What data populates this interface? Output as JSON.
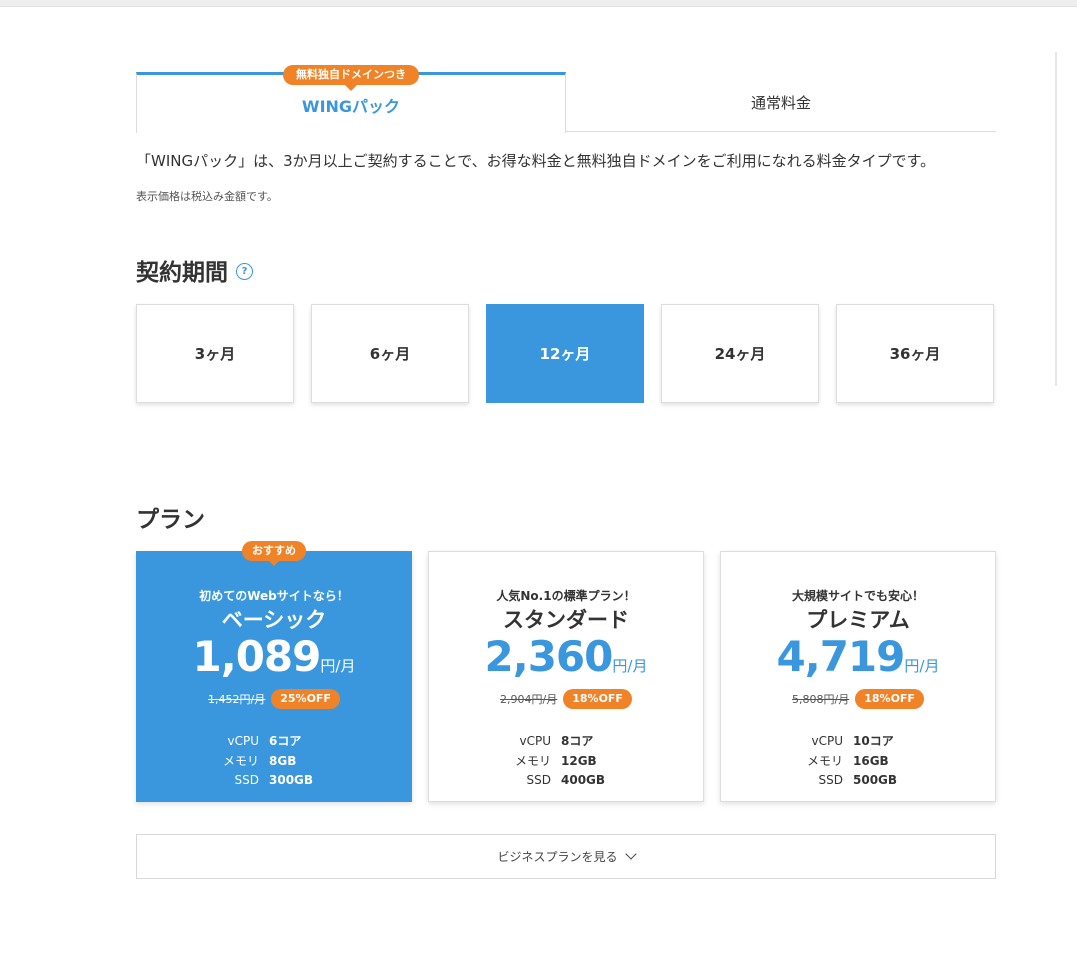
{
  "tabs": {
    "wing": {
      "label": "WINGパック",
      "badge": "無料独自ドメインつき"
    },
    "normal": {
      "label": "通常料金"
    }
  },
  "intro": "「WINGパック」は、3か月以上ご契約することで、お得な料金と無料独自ドメインをご利用になれる料金タイプです。",
  "tax_note": "表示価格は税込み金額です。",
  "period_section": {
    "title": "契約期間",
    "help_icon": "question-circle-icon",
    "options": [
      {
        "label": "3ヶ月"
      },
      {
        "label": "6ヶ月"
      },
      {
        "label": "12ヶ月"
      },
      {
        "label": "24ヶ月"
      },
      {
        "label": "36ヶ月"
      }
    ],
    "selected": "12ヶ月"
  },
  "plan_section": {
    "title": "プラン",
    "recommend_badge": "おすすめ",
    "spec_labels": [
      "vCPU",
      "メモリ",
      "SSD"
    ],
    "plans": [
      {
        "tagline": "初めてのWebサイトなら！",
        "name": "ベーシック",
        "price": "1,089",
        "price_unit": "円/月",
        "original_price": "1,452円/月",
        "discount": "25%OFF",
        "vcpu": "6コア",
        "memory": "8GB",
        "ssd": "300GB"
      },
      {
        "tagline": "人気No.1の標準プラン！",
        "name": "スタンダード",
        "price": "2,360",
        "price_unit": "円/月",
        "original_price": "2,904円/月",
        "discount": "18%OFF",
        "vcpu": "8コア",
        "memory": "12GB",
        "ssd": "400GB"
      },
      {
        "tagline": "大規模サイトでも安心！",
        "name": "プレミアム",
        "price": "4,719",
        "price_unit": "円/月",
        "original_price": "5,808円/月",
        "discount": "18%OFF",
        "vcpu": "10コア",
        "memory": "16GB",
        "ssd": "500GB"
      }
    ],
    "selected_plan": "ベーシック"
  },
  "business_button": {
    "label": "ビジネスプランを見る",
    "icon": "chevron-down-icon"
  },
  "colors": {
    "accent": "#3a97dd",
    "badge": "#f08228",
    "text": "#333333"
  }
}
